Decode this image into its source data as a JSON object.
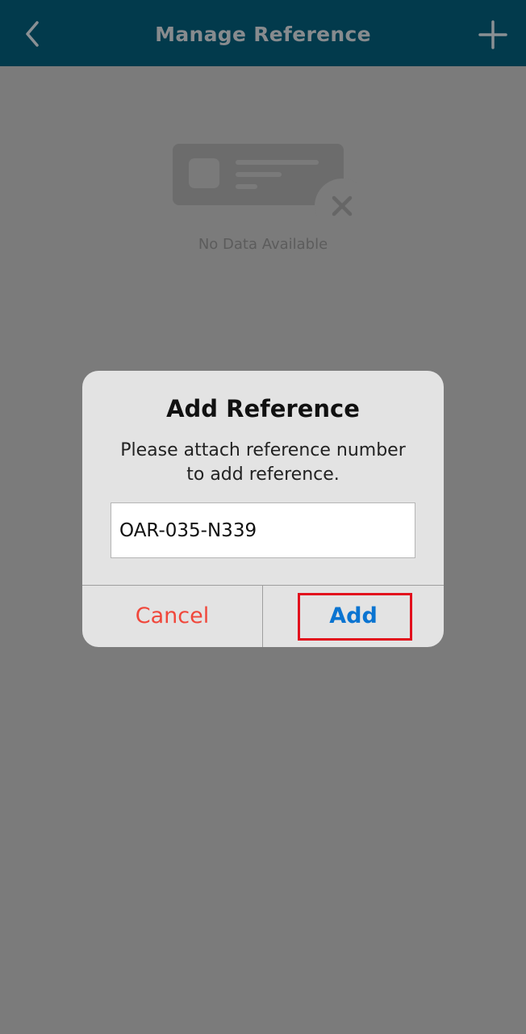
{
  "header": {
    "title": "Manage Reference",
    "back_icon": "chevron-left-icon",
    "add_icon": "plus-icon"
  },
  "empty_state": {
    "icon": "empty-card-icon",
    "text": "No Data Available"
  },
  "dialog": {
    "title": "Add Reference",
    "message": "Please attach reference number to add reference.",
    "input_value": "OAR-035-N339",
    "cancel_label": "Cancel",
    "add_label": "Add"
  },
  "colors": {
    "header_bg": "#023a4c",
    "overlay_bg": "#7b7b7b",
    "dialog_bg": "#e3e3e3",
    "cancel": "#f0473b",
    "add": "#0a74d1",
    "highlight": "#e2101d"
  }
}
